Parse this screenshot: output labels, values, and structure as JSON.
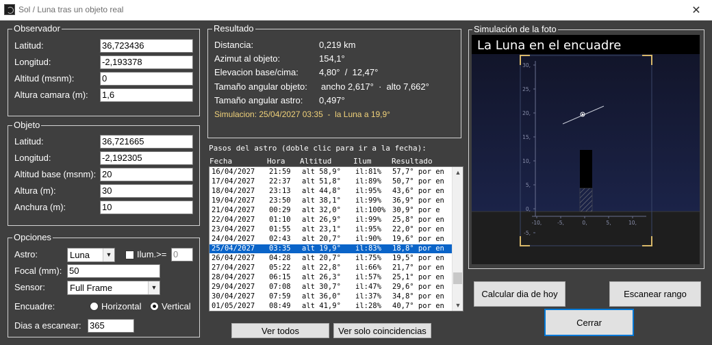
{
  "window": {
    "title": "Sol / Luna tras un objeto real",
    "close_glyph": "✕"
  },
  "observador": {
    "legend": "Observador",
    "fields": [
      {
        "label": "Latitud:",
        "value": "36,723436"
      },
      {
        "label": "Longitud:",
        "value": "-2,193378"
      },
      {
        "label": "Altitud (msnm):",
        "value": "0"
      },
      {
        "label": "Altura camara (m):",
        "value": "1,6"
      }
    ]
  },
  "objeto": {
    "legend": "Objeto",
    "fields": [
      {
        "label": "Latitud:",
        "value": "36,721665"
      },
      {
        "label": "Longitud:",
        "value": "-2,192305"
      },
      {
        "label": "Altitud base (msnm):",
        "value": "20"
      },
      {
        "label": "Altura (m):",
        "value": "30"
      },
      {
        "label": "Anchura (m):",
        "value": "10"
      }
    ]
  },
  "opciones": {
    "legend": "Opciones",
    "astro_label": "Astro:",
    "astro_value": "Luna",
    "ilum_label": "Ilum.>=",
    "ilum_value": "0",
    "focal_label": "Focal (mm):",
    "focal_value": "50",
    "sensor_label": "Sensor:",
    "sensor_value": "Full Frame",
    "encuadre_label": "Encuadre:",
    "horizontal_label": "Horizontal",
    "vertical_label": "Vertical",
    "encuadre_selected": "Vertical",
    "dias_label": "Dias a escanear:",
    "dias_value": "365"
  },
  "resultado": {
    "legend": "Resultado",
    "distancia_label": "Distancia:",
    "distancia_value": "0,219 km",
    "azimut_label": "Azimut al objeto:",
    "azimut_value": "154,1°",
    "elevacion_label": "Elevacion base/cima:",
    "elevacion_value": "4,80°  /  12,47°",
    "tam_obj_label": "Tamaño angular objeto:",
    "tam_obj_value": "ancho 2,617°  ·  alto 7,662°",
    "tam_astro_label": "Tamaño angular astro:",
    "tam_astro_value": "0,497°",
    "simulacion": "Simulacion: 25/04/2027 03:35  -  la Luna a 19,9°"
  },
  "pasos": {
    "title": "Pasos del astro (doble clic para ir a la fecha):",
    "headers": [
      "Fecha",
      "Hora",
      "Altitud",
      "Ilum",
      "Resultado"
    ],
    "selected_index": 9,
    "rows": [
      [
        "16/04/2027",
        "21:59",
        "alt 58,9°",
        "il:81%",
        "57,7° por en"
      ],
      [
        "17/04/2027",
        "22:37",
        "alt 51,8°",
        "il:89%",
        "50,7° por en"
      ],
      [
        "18/04/2027",
        "23:13",
        "alt 44,8°",
        "il:95%",
        "43,6° por en"
      ],
      [
        "19/04/2027",
        "23:50",
        "alt 38,1°",
        "il:99%",
        "36,9° por en"
      ],
      [
        "21/04/2027",
        "00:29",
        "alt 32,0°",
        "il:100%",
        "30,9° por e"
      ],
      [
        "22/04/2027",
        "01:10",
        "alt 26,9°",
        "il:99%",
        "25,8° por en"
      ],
      [
        "23/04/2027",
        "01:55",
        "alt 23,1°",
        "il:95%",
        "22,0° por en"
      ],
      [
        "24/04/2027",
        "02:43",
        "alt 20,7°",
        "il:90%",
        "19,6° por en"
      ],
      [
        "25/04/2027",
        "03:35",
        "alt 19,9°",
        "il:83%",
        "18,8° por en"
      ],
      [
        "26/04/2027",
        "04:28",
        "alt 20,7°",
        "il:75%",
        "19,5° por en"
      ],
      [
        "27/04/2027",
        "05:22",
        "alt 22,8°",
        "il:66%",
        "21,7° por en"
      ],
      [
        "28/04/2027",
        "06:15",
        "alt 26,3°",
        "il:57%",
        "25,1° por en"
      ],
      [
        "29/04/2027",
        "07:08",
        "alt 30,7°",
        "il:47%",
        "29,6° por en"
      ],
      [
        "30/04/2027",
        "07:59",
        "alt 36,0°",
        "il:37%",
        "34,8° por en"
      ],
      [
        "01/05/2027",
        "08:49",
        "alt 41,9°",
        "il:28%",
        "40,7° por en"
      ]
    ]
  },
  "buttons": {
    "ver_todos": "Ver todos",
    "ver_coincidencias": "Ver solo coincidencias",
    "calcular": "Calcular dia de hoy",
    "escanear": "Escanear rango",
    "cerrar": "Cerrar"
  },
  "simulacion_foto": {
    "legend": "Simulación de la foto",
    "caption": "La Luna en el encuadre",
    "y_ticks": [
      "30,",
      "25,",
      "20,",
      "15,",
      "10,",
      "5,",
      "0,",
      "-5,"
    ],
    "x_ticks": [
      "-10,",
      "-5,",
      "0,",
      "5,",
      "10,"
    ]
  }
}
